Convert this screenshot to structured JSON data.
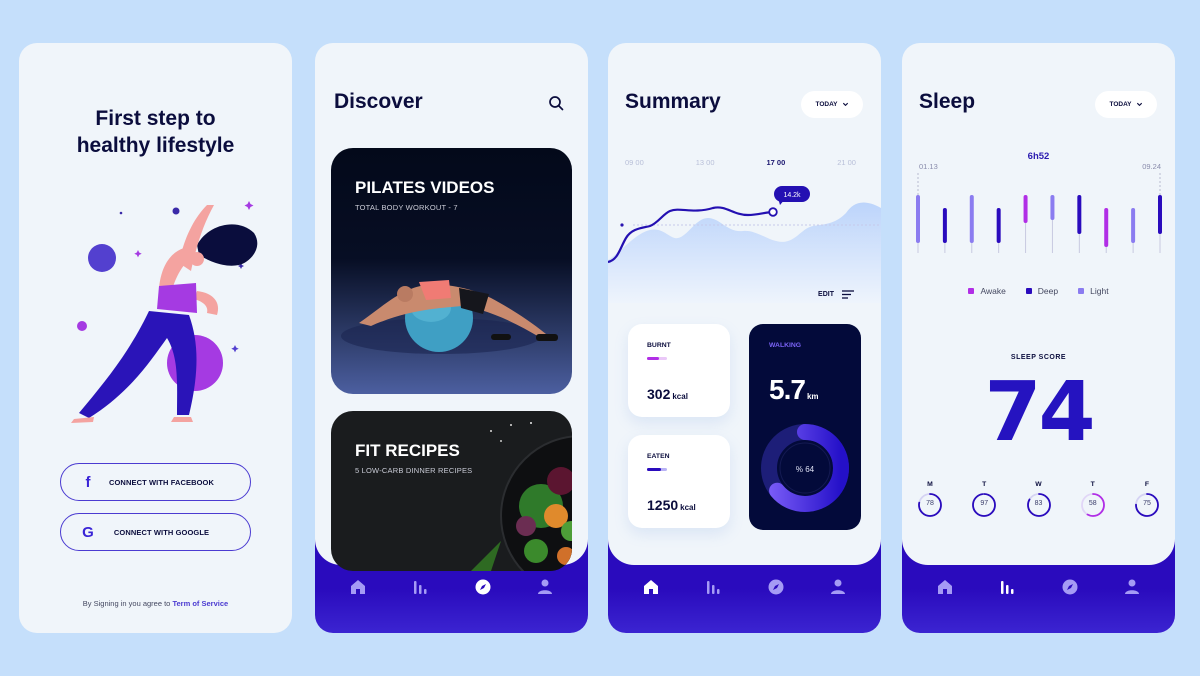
{
  "colors": {
    "background": "#c5dffb",
    "screen": "#f0f5fa",
    "primary": "#2a0bbd",
    "accent_purple": "#b12ee6",
    "light_purple": "#8b7cf0",
    "dark_navy": "#030a3a"
  },
  "nav": {
    "items": [
      {
        "name": "home",
        "icon": "home-icon"
      },
      {
        "name": "stats",
        "icon": "bar-chart-icon"
      },
      {
        "name": "discover",
        "icon": "compass-icon"
      },
      {
        "name": "profile",
        "icon": "user-icon"
      }
    ]
  },
  "onboarding": {
    "title_line1": "First step to",
    "title_line2": "healthy lifestyle",
    "illustration": "woman-exercising-illustration",
    "facebook_button": {
      "icon": "f",
      "label": "CONNECT WITH FACEBOOK"
    },
    "google_button": {
      "icon": "G",
      "label": "CONNECT WITH GOOGLE"
    },
    "terms_prefix": "By Signing in you agree to ",
    "terms_link": "Term of Service"
  },
  "discover": {
    "title": "Discover",
    "active_nav": "discover",
    "cards": [
      {
        "title": "PILATES VIDEOS",
        "subtitle": "TOTAL BODY WORKOUT - 7",
        "image": "woman-on-pilates-ball-photo"
      },
      {
        "title": "FIT RECIPES",
        "subtitle": "5 LOW-CARB DINNER RECIPES",
        "image": "salad-plate-photo"
      }
    ]
  },
  "summary": {
    "title": "Summary",
    "period": "TODAY",
    "active_nav": "home",
    "time_labels": [
      "09 00",
      "13 00",
      "17 00",
      "21 00"
    ],
    "active_time": "17 00",
    "tooltip": "14.2k",
    "edit_label": "EDIT",
    "burnt": {
      "label": "BURNT",
      "value": "302",
      "unit": "kcal",
      "progress": 0.6
    },
    "eaten": {
      "label": "EATEN",
      "value": "1250",
      "unit": "kcal",
      "progress": 0.7
    },
    "walking": {
      "label": "WALKING",
      "value": "5.7",
      "unit": "km",
      "percent_label": "% 64",
      "percent": 64
    }
  },
  "sleep": {
    "title": "Sleep",
    "period": "TODAY",
    "active_nav": "stats",
    "total": "6h52",
    "start_time": "01.13",
    "end_time": "09.24",
    "legend": [
      {
        "label": "Awake",
        "color": "#b12ee6"
      },
      {
        "label": "Deep",
        "color": "#2a0bbd"
      },
      {
        "label": "Light",
        "color": "#8b7cf0"
      }
    ],
    "score_label": "SLEEP SCORE",
    "score": "74",
    "days": [
      {
        "day": "M",
        "score": "78"
      },
      {
        "day": "T",
        "score": "97"
      },
      {
        "day": "W",
        "score": "83"
      },
      {
        "day": "T",
        "score": "58"
      },
      {
        "day": "F",
        "score": "75"
      }
    ]
  }
}
